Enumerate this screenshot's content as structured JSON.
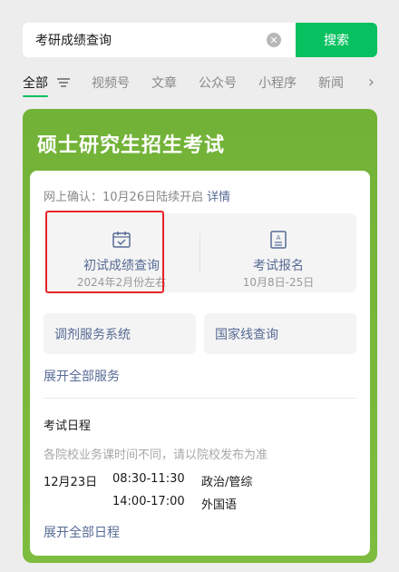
{
  "search": {
    "query": "考研成绩查询",
    "button_label": "搜索"
  },
  "tabs": [
    "全部",
    "视频号",
    "文章",
    "公众号",
    "小程序",
    "新闻"
  ],
  "card": {
    "title": "硕士研究生招生考试",
    "confirm_text": "网上确认：10月26日陆续开启",
    "confirm_link": "详情",
    "tiles": [
      {
        "icon": "calendar-check-icon",
        "label": "初试成绩查询",
        "sub": "2024年2月份左右"
      },
      {
        "icon": "document-icon",
        "label": "考试报名",
        "sub": "10月8日-25日"
      }
    ],
    "services": [
      "调剂服务系统",
      "国家线查询"
    ],
    "expand_services": "展开全部服务",
    "schedule_title": "考试日程",
    "schedule_note": "各院校业务课时间不同，请以院校发布为准",
    "schedule": [
      {
        "date": "12月23日",
        "time": "08:30-11:30",
        "subject": "政治/管综"
      },
      {
        "date": "",
        "time": "14:00-17:00",
        "subject": "外国语"
      }
    ],
    "expand_schedule": "展开全部日程"
  },
  "colors": {
    "accent_green": "#07c160",
    "card_green": "#76b63a",
    "link_blue": "#576b95",
    "highlight_red": "#e6232a"
  }
}
